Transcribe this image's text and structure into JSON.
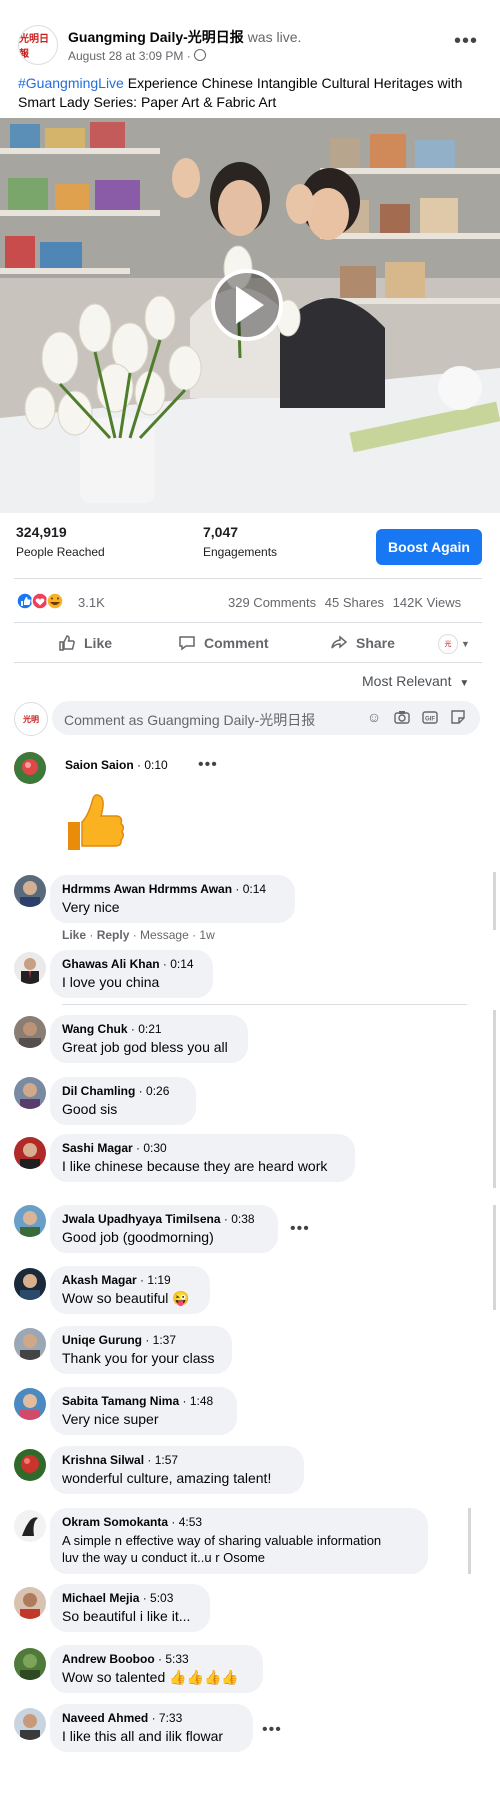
{
  "post": {
    "page_name": "Guangming Daily-光明日报",
    "was_live": "was live.",
    "time": "August 28 at 3:09 PM · ",
    "hashtag": "#GuangmingLive",
    "text": " Experience Chinese Intangible Cultural Heritages with Smart Lady Series: Paper Art & Fabric Art",
    "avatar_text": "光明日報"
  },
  "stats": {
    "reached_value": "324,919",
    "reached_label": "People Reached",
    "engagements_value": "7,047",
    "engagements_label": "Engagements",
    "boost_label": "Boost Again"
  },
  "reactions": {
    "count": "3.1K",
    "comments": "329 Comments",
    "shares": "45 Shares",
    "views": "142K Views"
  },
  "actions": {
    "like": "Like",
    "comment": "Comment",
    "share": "Share"
  },
  "sort_label": "Most Relevant",
  "composer_placeholder": "Comment as Guangming Daily-光明日报",
  "comment_meta": {
    "like": "Like",
    "reply": "Reply",
    "message": "Message",
    "age": "1w",
    "sep": " · "
  },
  "comments": [
    {
      "name": "Saion Saion",
      "time": "0:10",
      "text": "",
      "sticker": "thumbs-up"
    },
    {
      "name": "Hdrmms Awan Hdrmms Awan",
      "time": "0:14",
      "text": "Very nice"
    },
    {
      "name": "Ghawas Ali Khan",
      "time": "0:14",
      "text": "I love you china"
    },
    {
      "name": "Wang Chuk",
      "time": "0:21",
      "text": "Great job god bless you all"
    },
    {
      "name": "Dil Chamling",
      "time": "0:26",
      "text": "Good sis"
    },
    {
      "name": "Sashi Magar",
      "time": "0:30",
      "text": "I like chinese because they are heard work"
    },
    {
      "name": "Jwala Upadhyaya Timilsena",
      "time": "0:38",
      "text": "Good job (goodmorning)"
    },
    {
      "name": "Akash Magar",
      "time": "1:19",
      "text": "Wow so beautiful 😜"
    },
    {
      "name": "Uniqe Gurung",
      "time": "1:37",
      "text": "Thank you for your class"
    },
    {
      "name": "Sabita Tamang Nima",
      "time": "1:48",
      "text": "Very nice super"
    },
    {
      "name": "Krishna Silwal",
      "time": "1:57",
      "text": "wonderful culture, amazing talent!"
    },
    {
      "name": "Okram Somokanta",
      "time": "4:53",
      "text": "A simple n effective way of sharing valuable information",
      "text2": "luv the way u conduct it..u r Osome"
    },
    {
      "name": "Michael Mejia",
      "time": "5:03",
      "text": "So beautiful i like it..."
    },
    {
      "name": "Andrew Booboo",
      "time": "5:33",
      "text": "Wow so talented 👍👍👍👍"
    },
    {
      "name": "Naveed Ahmed",
      "time": "7:33",
      "text": "I like this all and ilik flowar"
    }
  ],
  "colors": {
    "brand_blue": "#1877f2",
    "hashtag_blue": "#216fdb",
    "bubble_bg": "#f0f2f5"
  }
}
